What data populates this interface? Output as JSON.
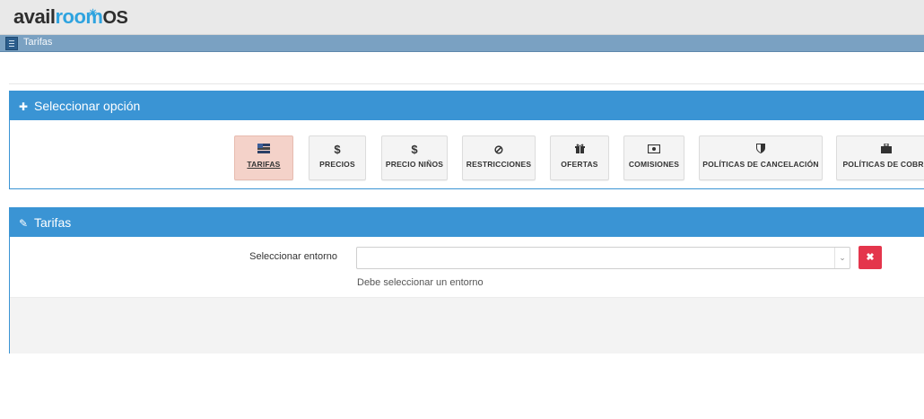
{
  "header": {
    "logo_part1": "avail",
    "logo_part2": "room",
    "logo_part3": "OS",
    "tab_label": "Tarifas"
  },
  "options_panel": {
    "title": "Seleccionar opción",
    "buttons": [
      {
        "label": "TARIFAS",
        "icon": "flag-icon",
        "active": true
      },
      {
        "label": "PRECIOS",
        "icon": "dollar-icon"
      },
      {
        "label": "PRECIO NIÑOS",
        "icon": "dollar-icon"
      },
      {
        "label": "RESTRICCIONES",
        "icon": "ban-icon"
      },
      {
        "label": "OFERTAS",
        "icon": "gift-icon"
      },
      {
        "label": "COMISIONES",
        "icon": "money-icon"
      },
      {
        "label": "POLÍTICAS DE CANCELACIÓN",
        "icon": "shield-icon"
      },
      {
        "label": "POLÍTICAS DE COBRO",
        "icon": "briefcase-icon"
      }
    ]
  },
  "tarifas_panel": {
    "title": "Tarifas",
    "form": {
      "label": "Seleccionar entorno",
      "select_value": "",
      "help_text": "Debe seleccionar un entorno"
    }
  },
  "colors": {
    "panel_header": "#3a94d4",
    "active_button": "#f4d2c9",
    "delete_button": "#e4354c",
    "tab_bar": "#7aa1c2"
  }
}
